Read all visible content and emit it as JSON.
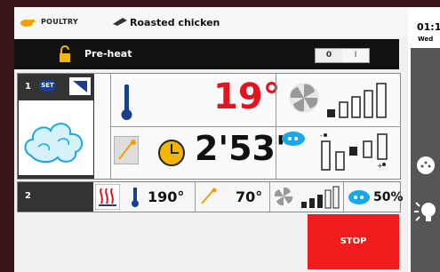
{
  "header": {
    "category": "POULTRY",
    "recipe_name": "Roasted chicken"
  },
  "status": {
    "clock": "01:1",
    "day": "Wed"
  },
  "preheat": {
    "label": "Pre-heat",
    "toggle_off": "0",
    "toggle_on": "I"
  },
  "step1": {
    "number": "1",
    "badge": "SET",
    "temperature": "19°",
    "time": "2'53\""
  },
  "step2": {
    "number": "2",
    "temp": "190°",
    "probe": "70°",
    "humidity": "50%"
  },
  "actions": {
    "stop": "STOP"
  },
  "colors": {
    "accent_red": "#ee1c1c",
    "dark_bar": "#111111",
    "steam_blue": "#1aa7e6"
  }
}
